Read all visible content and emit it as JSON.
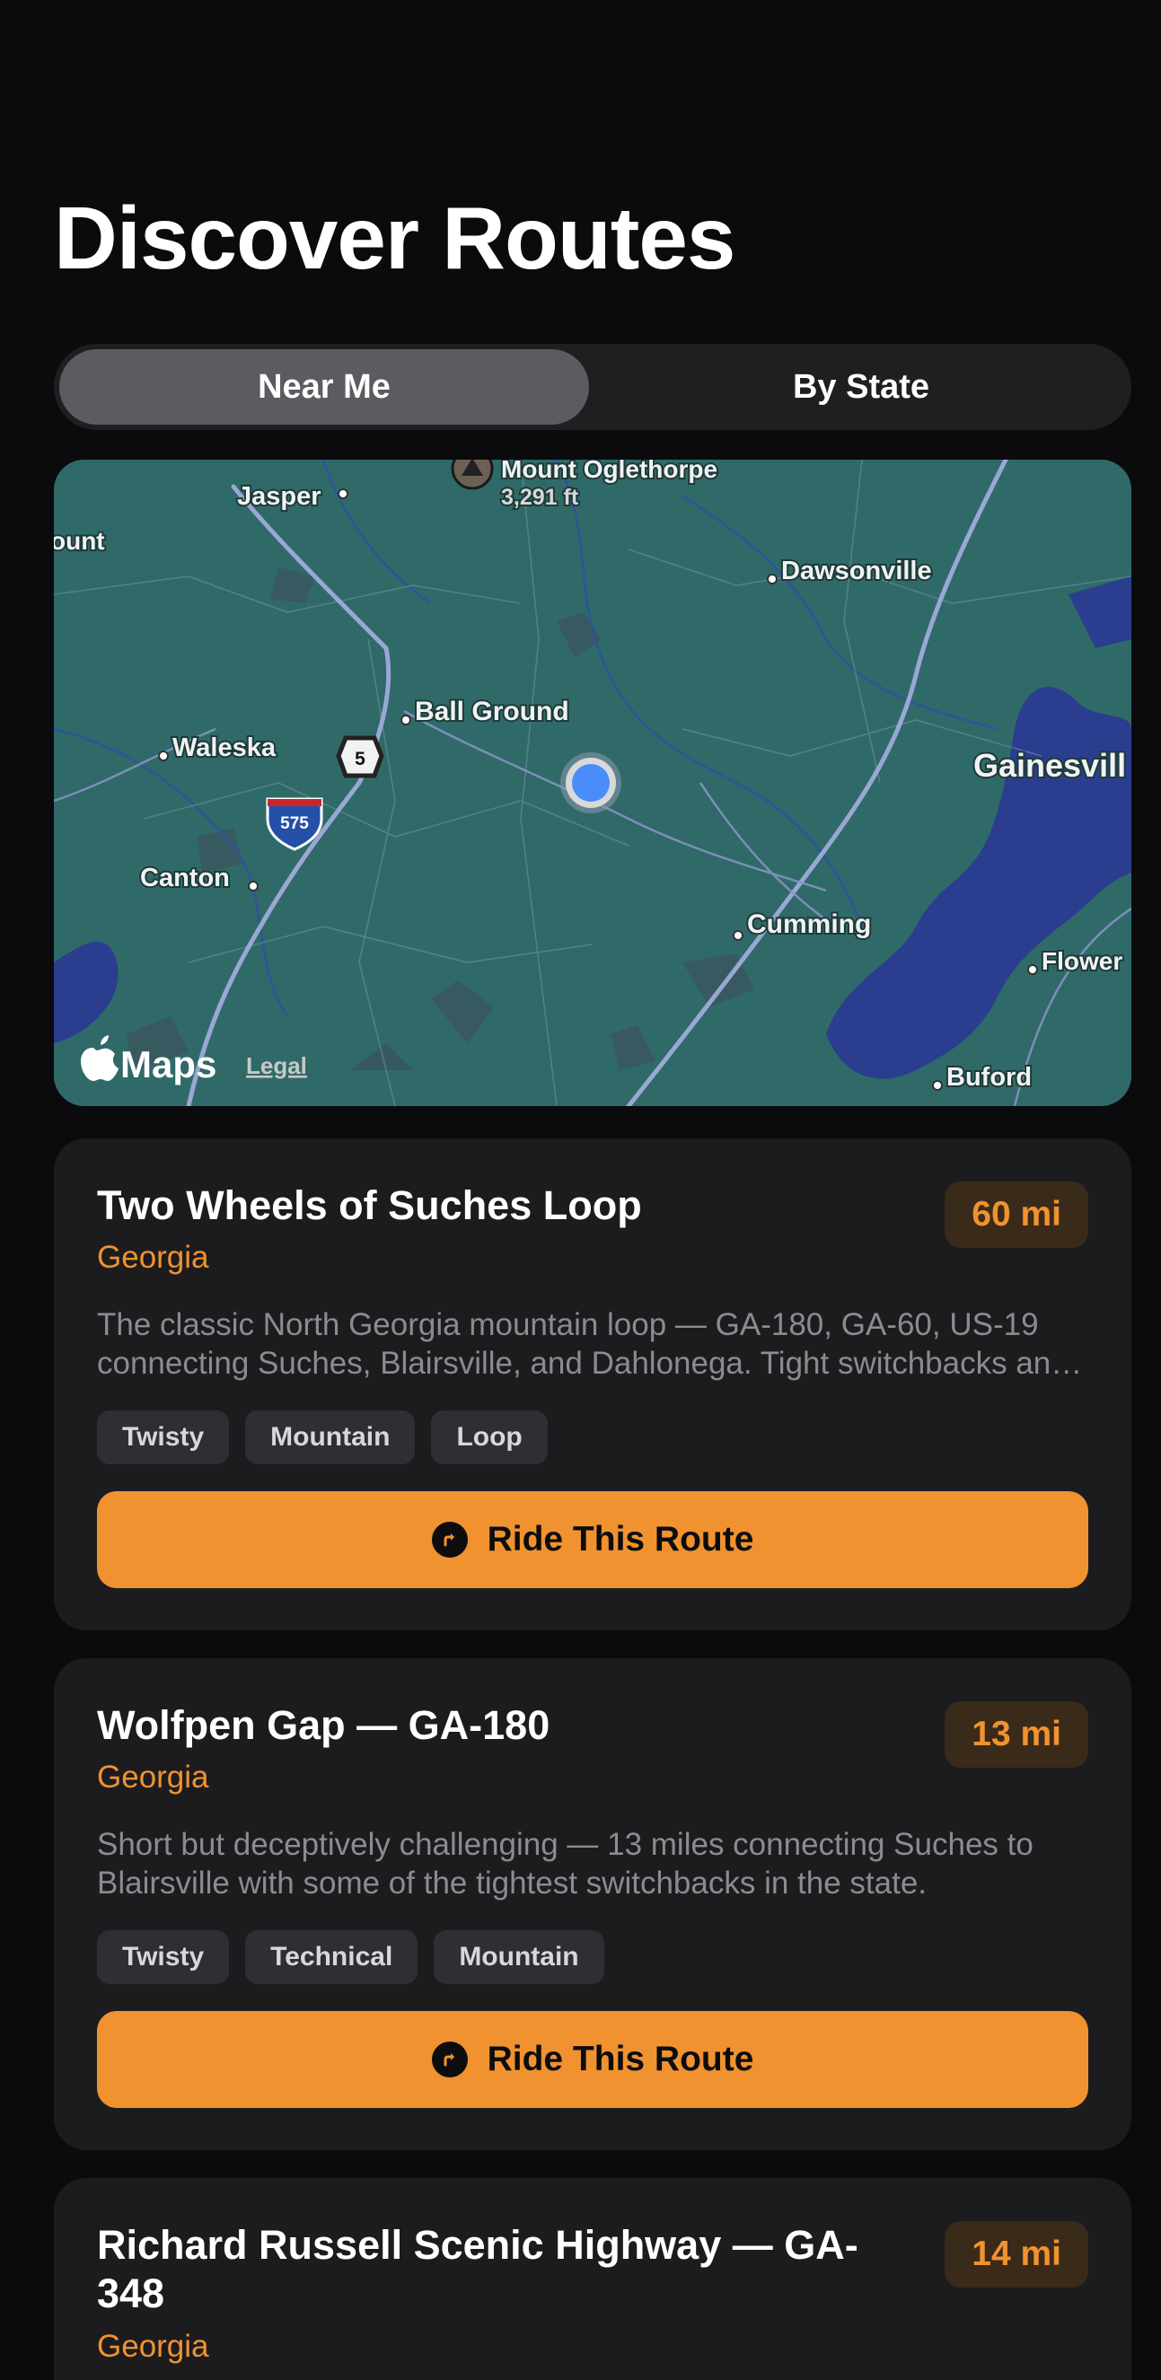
{
  "header": {
    "title": "Discover Routes"
  },
  "segments": {
    "near_me": "Near Me",
    "by_state": "By State"
  },
  "map": {
    "labels": {
      "mount_name": "Mount Oglethorpe",
      "mount_elevation": "3,291 ft",
      "jasper": "Jasper",
      "left_edge": "ount",
      "dawsonville": "Dawsonville",
      "ball_ground": "Ball Ground",
      "waleska": "Waleska",
      "gainesville": "Gainesvill",
      "canton": "Canton",
      "cumming": "Cumming",
      "flowery": "Flower",
      "buford": "Buford",
      "route_5": "5",
      "interstate_575": "575"
    },
    "attribution": {
      "brand": "Maps",
      "legal": "Legal"
    },
    "colors": {
      "land": "#2f6a68",
      "water": "#2b3d8f",
      "roads": "#9aa7d4"
    }
  },
  "routes": [
    {
      "title": "Two Wheels of Suches Loop",
      "state": "Georgia",
      "distance": "60 mi",
      "description": "The classic North Georgia mountain loop — GA-180, GA-60, US-19 connecting Suches, Blairsville, and Dahlonega. Tight switchbacks and sweeping mountain views.",
      "tags": [
        "Twisty",
        "Mountain",
        "Loop"
      ],
      "button": "Ride This Route"
    },
    {
      "title": "Wolfpen Gap — GA-180",
      "state": "Georgia",
      "distance": "13 mi",
      "description": "Short but deceptively challenging — 13 miles connecting Suches to Blairsville with some of the tightest switchbacks in the state.",
      "tags": [
        "Twisty",
        "Technical",
        "Mountain"
      ],
      "button": "Ride This Route"
    },
    {
      "title": "Richard Russell Scenic Highway — GA-348",
      "state": "Georgia",
      "distance": "14 mi"
    }
  ],
  "colors": {
    "accent": "#f0922f",
    "card": "#1c1c1f",
    "background": "#0b0b0d"
  }
}
